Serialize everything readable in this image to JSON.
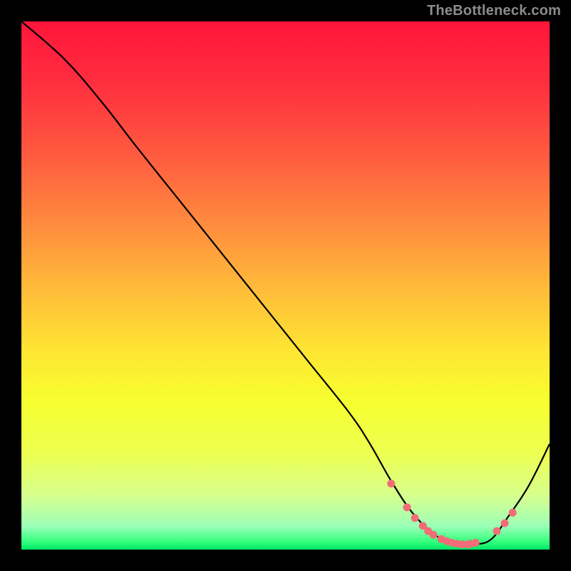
{
  "attribution": "TheBottleneck.com",
  "colors": {
    "page_bg": "#000000",
    "curve": "#000000",
    "marker_fill": "#f26d78",
    "marker_stroke": "#f26d78",
    "gradient_stops": [
      {
        "offset": 0.0,
        "color": "#ff153b"
      },
      {
        "offset": 0.12,
        "color": "#ff2f3f"
      },
      {
        "offset": 0.25,
        "color": "#ff5a40"
      },
      {
        "offset": 0.38,
        "color": "#ff8a3e"
      },
      {
        "offset": 0.5,
        "color": "#ffb93a"
      },
      {
        "offset": 0.62,
        "color": "#ffe433"
      },
      {
        "offset": 0.72,
        "color": "#f7ff2f"
      },
      {
        "offset": 0.82,
        "color": "#ecff52"
      },
      {
        "offset": 0.9,
        "color": "#d5ff8f"
      },
      {
        "offset": 0.955,
        "color": "#9dffb8"
      },
      {
        "offset": 0.985,
        "color": "#35ff7d"
      },
      {
        "offset": 1.0,
        "color": "#00e565"
      }
    ],
    "green_band": {
      "y0": 0.965,
      "y1": 1.0,
      "fill": "#1eff72",
      "opacity": 0.0
    }
  },
  "chart_data": {
    "type": "line",
    "title": "",
    "xlabel": "",
    "ylabel": "",
    "xlim": [
      0,
      100
    ],
    "ylim": [
      0,
      100
    ],
    "grid": false,
    "legend": false,
    "series": [
      {
        "name": "bottleneck-curve",
        "x": [
          0,
          8,
          15,
          22,
          30,
          38,
          46,
          54,
          62,
          66,
          70,
          74,
          78,
          82,
          86,
          89,
          92,
          96,
          100
        ],
        "y": [
          100,
          93,
          85,
          76,
          66,
          56,
          46,
          36,
          26,
          20,
          13,
          7,
          3,
          1,
          1,
          2,
          6,
          12,
          20
        ]
      }
    ],
    "markers": {
      "name": "sample-points",
      "x": [
        70,
        73,
        74.5,
        76,
        77,
        78,
        79.5,
        80.5,
        81.5,
        82.5,
        83.5,
        84.5,
        85,
        86,
        90,
        91.5,
        93
      ],
      "y": [
        12.5,
        8,
        6,
        4.5,
        3.5,
        2.8,
        2.0,
        1.6,
        1.3,
        1.1,
        1.0,
        1.0,
        1.1,
        1.3,
        3.5,
        5.0,
        7.0
      ],
      "radius": 5
    }
  }
}
